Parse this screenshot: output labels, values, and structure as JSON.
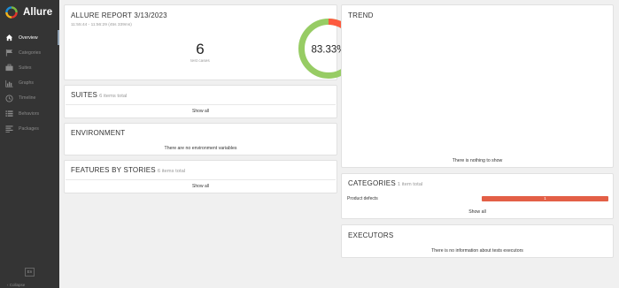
{
  "app": {
    "name": "Allure"
  },
  "sidebar": {
    "items": [
      {
        "label": "Overview",
        "icon": "home-icon",
        "active": true
      },
      {
        "label": "Categories",
        "icon": "flag-icon",
        "active": false
      },
      {
        "label": "Suites",
        "icon": "briefcase-icon",
        "active": false
      },
      {
        "label": "Graphs",
        "icon": "bar-chart-icon",
        "active": false
      },
      {
        "label": "Timeline",
        "icon": "clock-icon",
        "active": false
      },
      {
        "label": "Behaviors",
        "icon": "list-icon",
        "active": false
      },
      {
        "label": "Packages",
        "icon": "align-left-icon",
        "active": false
      }
    ],
    "lang": "En",
    "collapse": "Collapse"
  },
  "report": {
    "title": "ALLURE REPORT 3/13/2023",
    "time": "11:55:44 - 11:56:29 (45s 339ms)",
    "count": "6",
    "count_label": "test cases",
    "percent": "83.33%",
    "pass_fraction": 0.8333,
    "colors": {
      "passed": "#97cc64",
      "failed": "#fd5a3e"
    }
  },
  "suites": {
    "title": "SUITES",
    "sub": "6 items total",
    "show_all": "Show all"
  },
  "environment": {
    "title": "ENVIRONMENT",
    "message": "There are no environment variables"
  },
  "features": {
    "title": "FEATURES BY STORIES",
    "sub": "6 items total",
    "show_all": "Show all"
  },
  "trend": {
    "title": "TREND",
    "message": "There is nothing to show"
  },
  "categories": {
    "title": "CATEGORIES",
    "sub": "1 item total",
    "rows": [
      {
        "name": "Product defects",
        "count": "1"
      }
    ],
    "show_all": "Show all"
  },
  "executors": {
    "title": "EXECUTORS",
    "message": "There is no information about tests executors"
  }
}
